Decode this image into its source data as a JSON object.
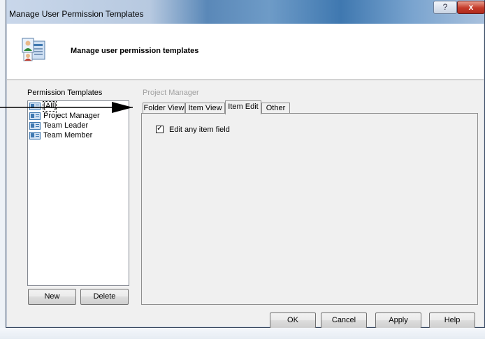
{
  "window": {
    "title": "Manage User Permission Templates",
    "help_glyph": "?",
    "close_glyph": "x"
  },
  "header": {
    "text": "Manage user permission templates",
    "icon": "user-permissions-icon"
  },
  "templates": {
    "label": "Permission Templates",
    "items": [
      {
        "label": "[All]",
        "selected": true
      },
      {
        "label": "Project Manager",
        "selected": false
      },
      {
        "label": "Team Leader",
        "selected": false
      },
      {
        "label": "Team Member",
        "selected": false
      }
    ],
    "new_label": "New",
    "delete_label": "Delete"
  },
  "detail": {
    "section_label": "Project Manager",
    "tabs": [
      {
        "label": "Folder View",
        "active": false
      },
      {
        "label": "Item View",
        "active": false
      },
      {
        "label": "Item Edit",
        "active": true
      },
      {
        "label": "Other",
        "active": false
      }
    ],
    "options": [
      {
        "label": "Edit any item field",
        "checked": true
      }
    ]
  },
  "footer": {
    "ok_label": "OK",
    "cancel_label": "Cancel",
    "apply_label": "Apply",
    "help_label": "Help"
  },
  "colors": {
    "accent": "#3f78b0",
    "selection": "#3399ff",
    "disabled_text": "#a0a0a0",
    "close_red": "#c43b2a"
  }
}
